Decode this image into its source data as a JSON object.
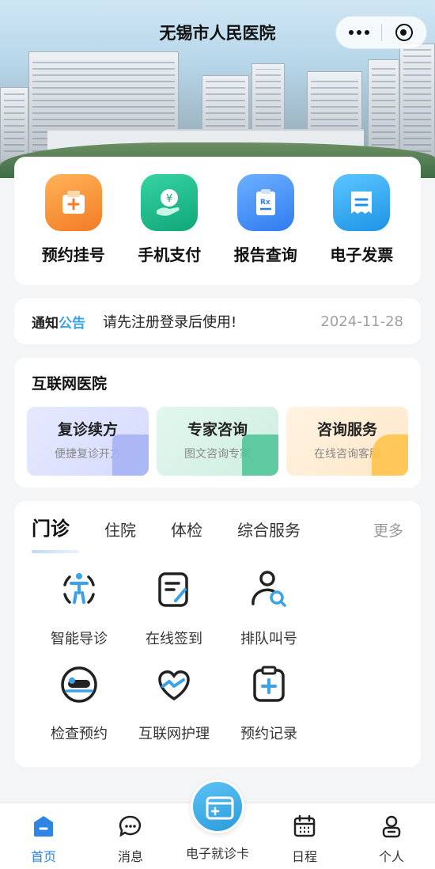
{
  "header": {
    "title": "无锡市人民医院",
    "more_icon": "more-dots-icon",
    "close_icon": "mini-program-close-icon"
  },
  "quick_services": [
    {
      "label": "预约挂号",
      "icon": "appointment-icon",
      "color": "#f58a2e"
    },
    {
      "label": "手机支付",
      "icon": "mobile-pay-icon",
      "color": "#1bb987"
    },
    {
      "label": "报告查询",
      "icon": "report-icon",
      "color": "#3a86f2"
    },
    {
      "label": "电子发票",
      "icon": "invoice-icon",
      "color": "#27a0ea"
    }
  ],
  "notice": {
    "label_a": "通知",
    "label_b": "公告",
    "message": "请先注册登录后使用!",
    "date": "2024-11-28"
  },
  "internet_hospital": {
    "title": "互联网医院",
    "tiles": [
      {
        "title": "复诊续方",
        "subtitle": "便捷复诊开方"
      },
      {
        "title": "专家咨询",
        "subtitle": "图文咨询专家"
      },
      {
        "title": "咨询服务",
        "subtitle": "在线咨询客服"
      }
    ]
  },
  "clinic": {
    "tabs": [
      "门诊",
      "住院",
      "体检",
      "综合服务"
    ],
    "active_tab": "门诊",
    "more": "更多",
    "items": [
      {
        "label": "智能导诊",
        "icon": "smart-guide-icon"
      },
      {
        "label": "在线签到",
        "icon": "online-checkin-icon"
      },
      {
        "label": "排队叫号",
        "icon": "queue-call-icon"
      },
      {
        "label": "检查预约",
        "icon": "exam-booking-icon"
      },
      {
        "label": "互联网护理",
        "icon": "internet-nursing-icon"
      },
      {
        "label": "预约记录",
        "icon": "booking-record-icon"
      }
    ]
  },
  "tabbar": [
    {
      "label": "首页",
      "icon": "home-icon",
      "active": true
    },
    {
      "label": "消息",
      "icon": "message-icon"
    },
    {
      "label": "电子就诊卡",
      "icon": "medical-card-icon"
    },
    {
      "label": "日程",
      "icon": "calendar-icon"
    },
    {
      "label": "个人",
      "icon": "profile-icon"
    }
  ],
  "colors": {
    "accent": "#2d86e6",
    "notice_blue": "#3aa3e8"
  }
}
